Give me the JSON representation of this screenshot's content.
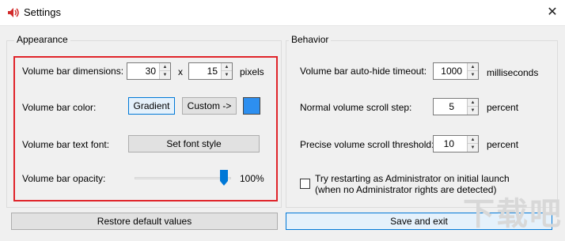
{
  "window": {
    "title": "Settings",
    "close_glyph": "✕",
    "icon": "speaker-icon"
  },
  "appearance": {
    "group_label": "Appearance",
    "dimensions_label": "Volume bar dimensions:",
    "width_value": "30",
    "x_sep": "x",
    "height_value": "15",
    "pixels_unit": "pixels",
    "color_label": "Volume bar color:",
    "gradient_button": "Gradient",
    "custom_button": "Custom ->",
    "color_swatch": "#2d8ff0",
    "font_label": "Volume bar text font:",
    "font_button": "Set font style",
    "opacity_label": "Volume bar opacity:",
    "opacity_value": "100%",
    "opacity_level": 1.0
  },
  "behavior": {
    "group_label": "Behavior",
    "autohide_label": "Volume bar auto-hide timeout:",
    "autohide_value": "1000",
    "autohide_unit": "milliseconds",
    "scroll_step_label": "Normal volume scroll step:",
    "scroll_step_value": "5",
    "scroll_step_unit": "percent",
    "precise_label": "Precise volume scroll threshold:",
    "precise_value": "10",
    "precise_unit": "percent",
    "admin_checkbox_line1": "Try restarting as Administrator on initial launch",
    "admin_checkbox_line2": "(when no Administrator rights are detected)",
    "admin_checked": false
  },
  "footer": {
    "restore_button": "Restore default values",
    "save_button": "Save and exit"
  },
  "watermark": {
    "logo_text": "下载吧"
  },
  "colors": {
    "highlight": "#e0242a",
    "accent": "#0078d7",
    "swatch": "#2d8ff0"
  }
}
